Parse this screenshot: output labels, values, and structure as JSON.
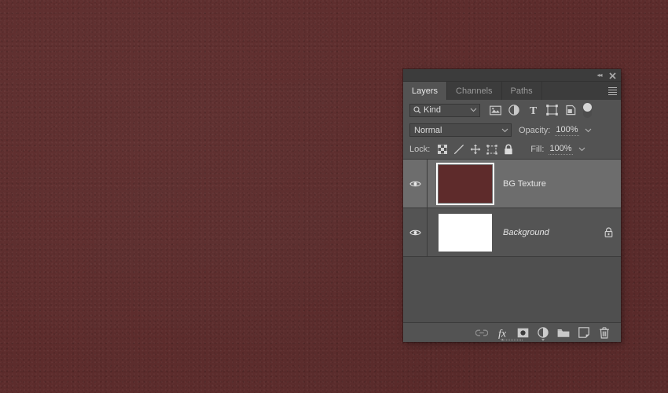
{
  "canvas": {
    "background_color": "#5d2c2c",
    "texture_name": "dark-red-leather-texture"
  },
  "panel": {
    "name": "Layers Panel",
    "titlebar": {
      "collapse_icon": "double-chevron-left-icon",
      "close_icon": "close-icon"
    },
    "tabs": [
      {
        "label": "Layers",
        "active": true
      },
      {
        "label": "Channels",
        "active": false
      },
      {
        "label": "Paths",
        "active": false
      }
    ],
    "panel_menu_icon": "hamburger-menu-icon",
    "filter_row": {
      "search_icon": "magnifier-icon",
      "kind_value": "Kind",
      "dropdown_icon": "chevron-down-icon",
      "filter_icons": [
        "pixel-layer-filter-icon",
        "adjustment-layer-filter-icon",
        "type-layer-filter-icon",
        "shape-layer-filter-icon",
        "smart-object-filter-icon"
      ],
      "toggle_icon": "filter-toggle-switch"
    },
    "blend_row": {
      "blend_mode": "Normal",
      "blend_dropdown_icon": "chevron-down-icon",
      "opacity_label": "Opacity:",
      "opacity_value": "100%",
      "opacity_dropdown_icon": "chevron-down-icon"
    },
    "lock_row": {
      "lock_label": "Lock:",
      "lock_icons": [
        "lock-transparent-pixels-icon",
        "lock-image-pixels-brush-icon",
        "lock-position-move-icon",
        "lock-artboard-nesting-icon",
        "lock-all-padlock-icon"
      ],
      "fill_label": "Fill:",
      "fill_value": "100%",
      "fill_dropdown_icon": "chevron-down-icon"
    },
    "layers": [
      {
        "name": "BG Texture",
        "visible": true,
        "selected": true,
        "italic": false,
        "locked": false,
        "thumbnail_color": "#5e2b2b",
        "eye_icon": "eye-visibility-icon"
      },
      {
        "name": "Background",
        "visible": true,
        "selected": false,
        "italic": true,
        "locked": true,
        "thumbnail_color": "#ffffff",
        "eye_icon": "eye-visibility-icon",
        "lock_icon": "padlock-icon"
      }
    ],
    "bottom_toolbar": [
      {
        "icon": "link-layers-icon",
        "label": "Link layers",
        "dim": true,
        "has_caret": false
      },
      {
        "icon": "fx-layer-style-icon",
        "label": "Add layer style",
        "dim": false,
        "has_caret": true
      },
      {
        "icon": "layer-mask-icon",
        "label": "Add layer mask",
        "dim": false,
        "has_caret": false
      },
      {
        "icon": "new-adjustment-layer-icon",
        "label": "New adjustment layer",
        "dim": false,
        "has_caret": true
      },
      {
        "icon": "new-group-folder-icon",
        "label": "Create new group",
        "dim": false,
        "has_caret": false
      },
      {
        "icon": "new-layer-icon",
        "label": "Create new layer",
        "dim": false,
        "has_caret": false
      },
      {
        "icon": "delete-layer-trash-icon",
        "label": "Delete layer",
        "dim": false,
        "has_caret": false
      }
    ]
  }
}
